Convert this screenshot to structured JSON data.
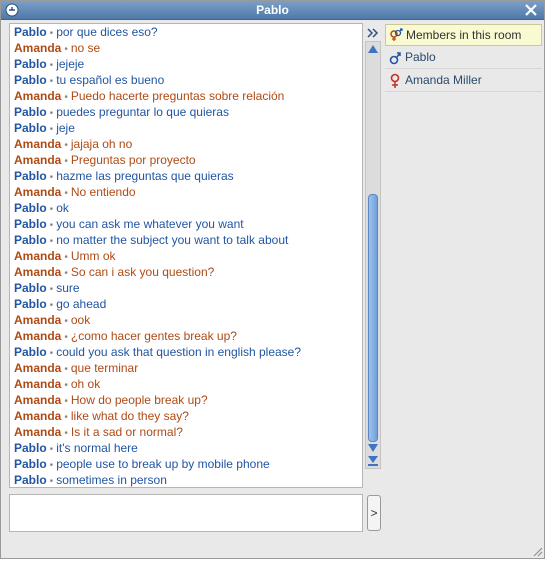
{
  "window": {
    "title": "Pablo"
  },
  "messages": [
    {
      "sender": "Pablo",
      "text": "por que dices eso?"
    },
    {
      "sender": "Amanda",
      "text": "no se"
    },
    {
      "sender": "Pablo",
      "text": "jejeje"
    },
    {
      "sender": "Pablo",
      "text": "tu español es bueno"
    },
    {
      "sender": "Amanda",
      "text": "Puedo  hacerte preguntas sobre relación"
    },
    {
      "sender": "Pablo",
      "text": "puedes preguntar lo que quieras"
    },
    {
      "sender": "Pablo",
      "text": "jeje"
    },
    {
      "sender": "Amanda",
      "text": "jajaja oh no"
    },
    {
      "sender": "Amanda",
      "text": "Preguntas por proyecto"
    },
    {
      "sender": "Pablo",
      "text": "hazme las preguntas que quieras"
    },
    {
      "sender": "Amanda",
      "text": "No entiendo"
    },
    {
      "sender": "Pablo",
      "text": "ok"
    },
    {
      "sender": "Pablo",
      "text": "you can ask me whatever you want"
    },
    {
      "sender": "Pablo",
      "text": "no matter the subject you want to talk about"
    },
    {
      "sender": "Amanda",
      "text": "Umm ok"
    },
    {
      "sender": "Amanda",
      "text": "So can i ask you question?"
    },
    {
      "sender": "Pablo",
      "text": "sure"
    },
    {
      "sender": "Pablo",
      "text": "go ahead"
    },
    {
      "sender": "Amanda",
      "text": "ook"
    },
    {
      "sender": "Amanda",
      "text": "¿como hacer gentes break up?"
    },
    {
      "sender": "Pablo",
      "text": "could you ask that question in english please?"
    },
    {
      "sender": "Amanda",
      "text": "que terminar"
    },
    {
      "sender": "Amanda",
      "text": "oh ok"
    },
    {
      "sender": "Amanda",
      "text": "How do people break up?"
    },
    {
      "sender": "Amanda",
      "text": "like what do they say?"
    },
    {
      "sender": "Amanda",
      "text": "Is it a sad or normal?"
    },
    {
      "sender": "Pablo",
      "text": "it's normal here"
    },
    {
      "sender": "Pablo",
      "text": "people use to break up by mobile phone"
    },
    {
      "sender": "Pablo",
      "text": "sometimes in person"
    }
  ],
  "members": {
    "header": "Members in this room",
    "list": [
      {
        "name": "Pablo",
        "gender": "male"
      },
      {
        "name": "Amanda Miller",
        "gender": "female"
      }
    ]
  },
  "composer": {
    "value": "",
    "send_label": ">"
  },
  "controls": {
    "collapse_label": "»"
  },
  "colors": {
    "pablo": "#2155a3",
    "amanda": "#b04a14",
    "titlebar": "#5b84b1"
  }
}
